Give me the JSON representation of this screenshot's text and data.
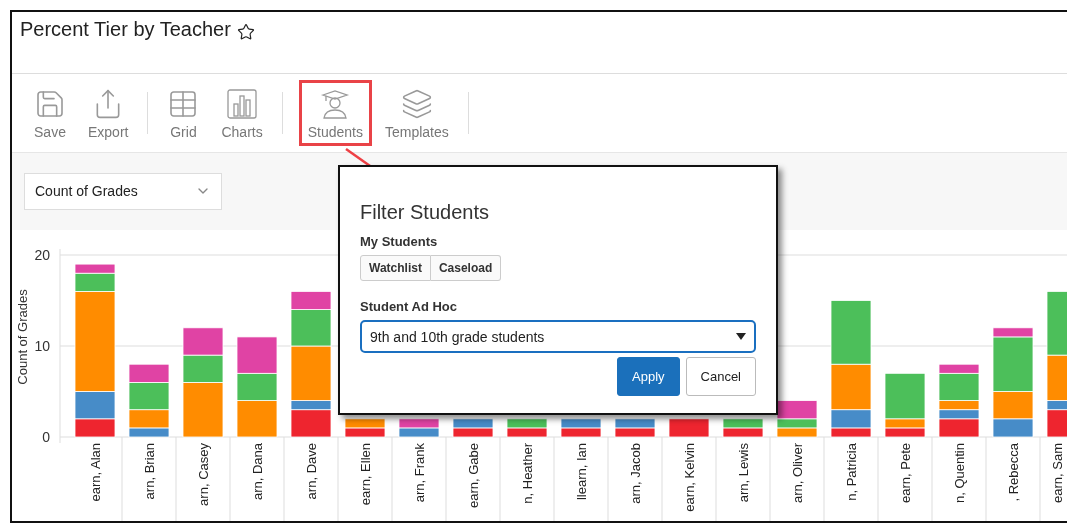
{
  "header": {
    "title": "Percent Tier by Teacher",
    "favorite": false
  },
  "toolbar": {
    "groups": [
      [
        {
          "kind": "save",
          "label": "Save",
          "selected": false
        },
        {
          "kind": "export",
          "label": "Export",
          "selected": false
        }
      ],
      [
        {
          "kind": "grid",
          "label": "Grid",
          "selected": false
        },
        {
          "kind": "charts",
          "label": "Charts",
          "selected": false
        }
      ],
      [
        {
          "kind": "students",
          "label": "Students",
          "selected": true
        },
        {
          "kind": "templates",
          "label": "Templates",
          "selected": false
        }
      ]
    ]
  },
  "measure_select": {
    "value": "Count of Grades"
  },
  "chart": {
    "chart_data": {
      "type": "bar",
      "stacked": true,
      "ylabel": "Count of Grades",
      "ylim": [
        0,
        20
      ],
      "yticks": [
        0,
        10,
        20
      ],
      "categories": [
        "earn, Alan",
        "arn, Brian",
        "arn, Casey",
        "arn, Dana",
        "arn, Dave",
        "earn, Ellen",
        "arn, Frank",
        "earn, Gabe",
        "n, Heather",
        "llearn, Ian",
        "arn, Jacob",
        "earn, Kelvin",
        "arn, Lewis",
        "arn, Oliver",
        "n, Patricia",
        "earn, Pete",
        "n, Quentin",
        ", Rebecca",
        "earn, Sam"
      ],
      "series": [
        {
          "color": "#ee252f",
          "values": [
            2,
            0,
            0,
            0,
            3,
            1,
            0,
            1,
            1,
            1,
            1,
            2,
            1,
            0,
            1,
            1,
            2,
            0,
            3
          ]
        },
        {
          "color": "#478cc8",
          "values": [
            3,
            1,
            0,
            0,
            1,
            0,
            1,
            1,
            0,
            1,
            1,
            0,
            0,
            0,
            2,
            0,
            1,
            2,
            1
          ]
        },
        {
          "color": "#ff8c00",
          "values": [
            11,
            2,
            6,
            4,
            6,
            1,
            0,
            0,
            0,
            0,
            0,
            0,
            0,
            1,
            5,
            1,
            1,
            3,
            5
          ]
        },
        {
          "color": "#4cbf5a",
          "values": [
            2,
            3,
            3,
            3,
            4,
            0,
            0,
            0,
            1,
            0,
            0,
            0,
            1,
            1,
            7,
            5,
            3,
            6,
            7
          ]
        },
        {
          "color": "#e043a4",
          "values": [
            1,
            2,
            3,
            4,
            2,
            0,
            1,
            0,
            0,
            0,
            0,
            0,
            0,
            2,
            0,
            0,
            1,
            1,
            0
          ]
        }
      ]
    }
  },
  "filter_dialog": {
    "title": "Filter Students",
    "my_students_label": "My Students",
    "my_students_buttons": [
      "Watchlist",
      "Caseload"
    ],
    "ad_hoc_label": "Student Ad Hoc",
    "ad_hoc_value": "9th and 10th grade students",
    "buttons": [
      {
        "kind": "primary",
        "label": "Apply"
      },
      {
        "kind": "secondary",
        "label": "Cancel"
      }
    ]
  }
}
